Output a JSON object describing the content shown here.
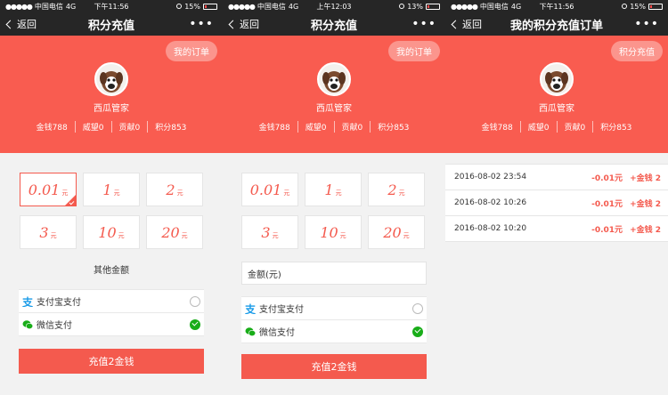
{
  "status": {
    "carrier": "中国电信",
    "network": "4G",
    "battery": "15%",
    "battery_2": "13%",
    "times": [
      "下午11:56",
      "上午12:03",
      "下午11:56"
    ]
  },
  "nav": {
    "back_label": "返回",
    "recharge_title": "积分充值",
    "orders_title": "我的积分充值订单",
    "more": "•••"
  },
  "header": {
    "orders_button": "我的订单",
    "recharge_button": "积分充值",
    "username": "西瓜管家",
    "stats": [
      "金钱788",
      "威望0",
      "贡献0",
      "积分853"
    ]
  },
  "amounts": [
    {
      "value": "0.01",
      "unit": "元"
    },
    {
      "value": "1",
      "unit": "元"
    },
    {
      "value": "2",
      "unit": "元"
    },
    {
      "value": "3",
      "unit": "元"
    },
    {
      "value": "10",
      "unit": "元"
    },
    {
      "value": "20",
      "unit": "元"
    }
  ],
  "other_amount_label": "其他金额",
  "amount_input_placeholder": "金额(元)",
  "payment": {
    "alipay": "支付宝支付",
    "wechat": "微信支付"
  },
  "submit_label": "充值2金钱",
  "orders": [
    {
      "time": "2016-08-02 23:54",
      "amount": "-0.01元",
      "reward": "+金钱 2"
    },
    {
      "time": "2016-08-02 10:26",
      "amount": "-0.01元",
      "reward": "+金钱 2"
    },
    {
      "time": "2016-08-02 10:20",
      "amount": "-0.01元",
      "reward": "+金钱 2"
    }
  ],
  "colors": {
    "accent": "#f45a4e",
    "header": "#f95c50",
    "bar": "#262626",
    "wechat_green": "#19ad19",
    "alipay_blue": "#1a9be8"
  }
}
